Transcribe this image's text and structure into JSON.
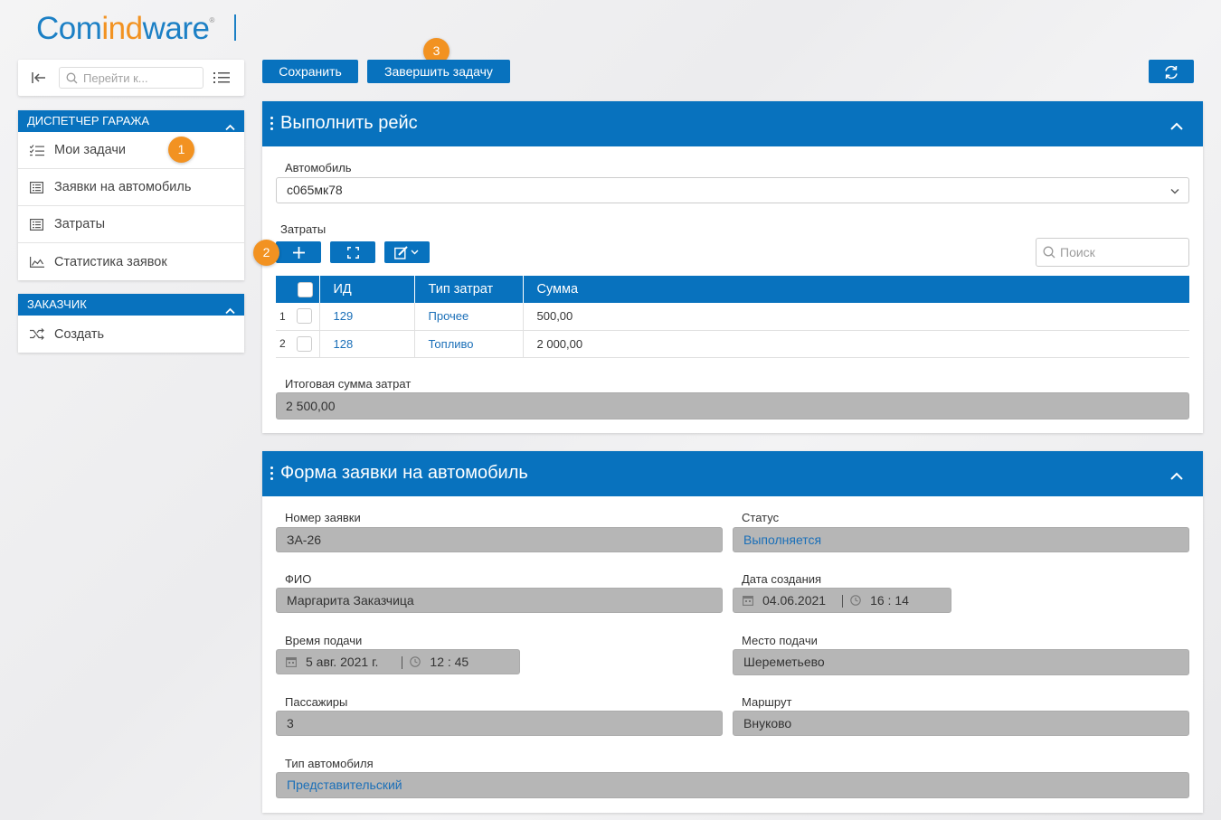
{
  "logo": {
    "part1": "Com",
    "part2": "ind",
    "part3": "ware",
    "reg": "®"
  },
  "nav": {
    "search_placeholder": "Перейти к...",
    "groups": [
      {
        "title": "ДИСПЕТЧЕР ГАРАЖА",
        "items": [
          "Мои задачи",
          "Заявки на автомобиль",
          "Затраты",
          "Статистика заявок"
        ]
      },
      {
        "title": "ЗАКАЗЧИК",
        "items": [
          "Создать"
        ]
      }
    ]
  },
  "badges": {
    "b1": "1",
    "b2": "2",
    "b3": "3"
  },
  "toolbar": {
    "save": "Сохранить",
    "finish": "Завершить задачу"
  },
  "panel1": {
    "title": "Выполнить рейс",
    "car_label": "Автомобиль",
    "car_value": "с065мк78",
    "costs_label": "Затраты",
    "search_placeholder": "Поиск",
    "columns": [
      "ИД",
      "Тип затрат",
      "Сумма"
    ],
    "rows": [
      {
        "n": "1",
        "id": "129",
        "type": "Прочее",
        "sum": "500,00"
      },
      {
        "n": "2",
        "id": "128",
        "type": "Топливо",
        "sum": "2 000,00"
      }
    ],
    "total_label": "Итоговая сумма затрат",
    "total_value": "2 500,00"
  },
  "panel2": {
    "title": "Форма заявки на автомобиль",
    "number_label": "Номер заявки",
    "number_value": "ЗА-26",
    "status_label": "Статус",
    "status_value": "Выполняется",
    "fio_label": "ФИО",
    "fio_value": "Маргарита Заказчица",
    "created_label": "Дата создания",
    "created_date": "04.06.2021",
    "created_time": "16 : 14",
    "time_label": "Время подачи",
    "time_date": "5 авг. 2021 г.",
    "time_time": "12 : 45",
    "place_label": "Место подачи",
    "place_value": "Шереметьево",
    "pass_label": "Пассажиры",
    "pass_value": "3",
    "route_label": "Маршрут",
    "route_value": "Внуково",
    "cartype_label": "Тип автомобиля",
    "cartype_value": "Представительский"
  },
  "colors": {
    "primary": "#0872be",
    "accent": "#f29221",
    "link": "#1a6fb8"
  }
}
